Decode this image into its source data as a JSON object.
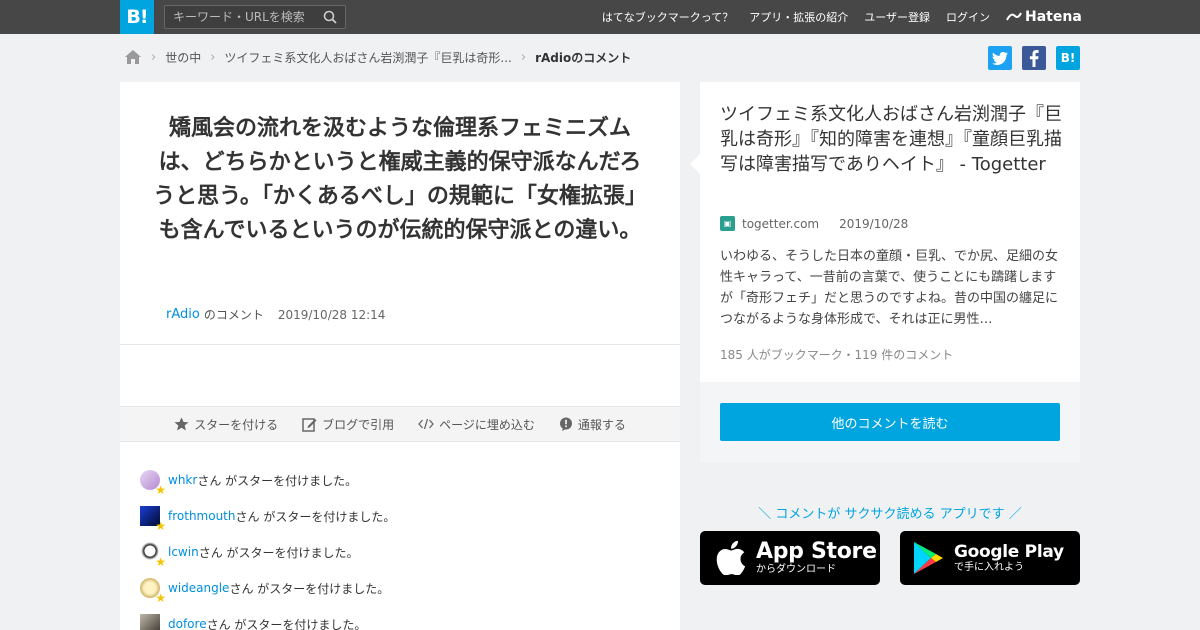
{
  "header": {
    "logo_text": "B!",
    "search_placeholder": "キーワード・URLを検索",
    "nav": [
      "はてなブックマークって？",
      "アプリ・拡張の紹介",
      "ユーザー登録",
      "ログイン"
    ],
    "brand": "Hatena"
  },
  "breadcrumb": {
    "items": [
      "世の中",
      "ツイフェミ系文化人おばさん岩渕潤子『巨乳は奇形..."
    ],
    "current": "rAdioのコメント"
  },
  "share": {
    "bookmark_label": "B!"
  },
  "comment": {
    "text": "矯風会の流れを汲むような倫理系フェミニズムは、どちらかというと権威主義的保守派なんだろうと思う。「かくあるべし」の規範に「女権拡張」も含んでいるというのが伝統的保守派との違い。",
    "user": "rAdio",
    "user_suffix": "のコメント",
    "datetime": "2019/10/28 12:14"
  },
  "actions": {
    "star": "スターを付ける",
    "blog": "ブログで引用",
    "embed": "ページに埋め込む",
    "report": "通報する"
  },
  "stars": {
    "suffix": "さん がスターを付けました。",
    "users": [
      "whkr",
      "frothmouth",
      "lcwin",
      "wideangle",
      "dofore"
    ]
  },
  "entry": {
    "title": "ツイフェミ系文化人おばさん岩渕潤子『巨乳は奇形』『知的障害を連想』『童顔巨乳描写は障害描写でありヘイト』 - Togetter",
    "site": "togetter.com",
    "date": "2019/10/28",
    "excerpt": "いわゆる、そうした日本の童顔・巨乳、でか尻、足細の女性キャラって、一昔前の言葉で、使うことにも躊躇しますが「奇形フェチ」だと思うのですよね。昔の中国の纏足につながるような身体形成で、それは正に男性…",
    "counts": "185 人がブックマーク・119 件のコメント",
    "read_more": "他のコメントを読む"
  },
  "promo": {
    "text": "＼ コメントが サクサク読める アプリです ／",
    "appstore_big": "App Store",
    "appstore_small": "からダウンロード",
    "googleplay_big": "Google Play",
    "googleplay_small": "で手に入れよう"
  },
  "colors": {
    "header_bg": "#474747",
    "accent": "#00a4de",
    "twitter": "#1da1f2",
    "facebook": "#3b5998",
    "star": "#f5c400"
  }
}
